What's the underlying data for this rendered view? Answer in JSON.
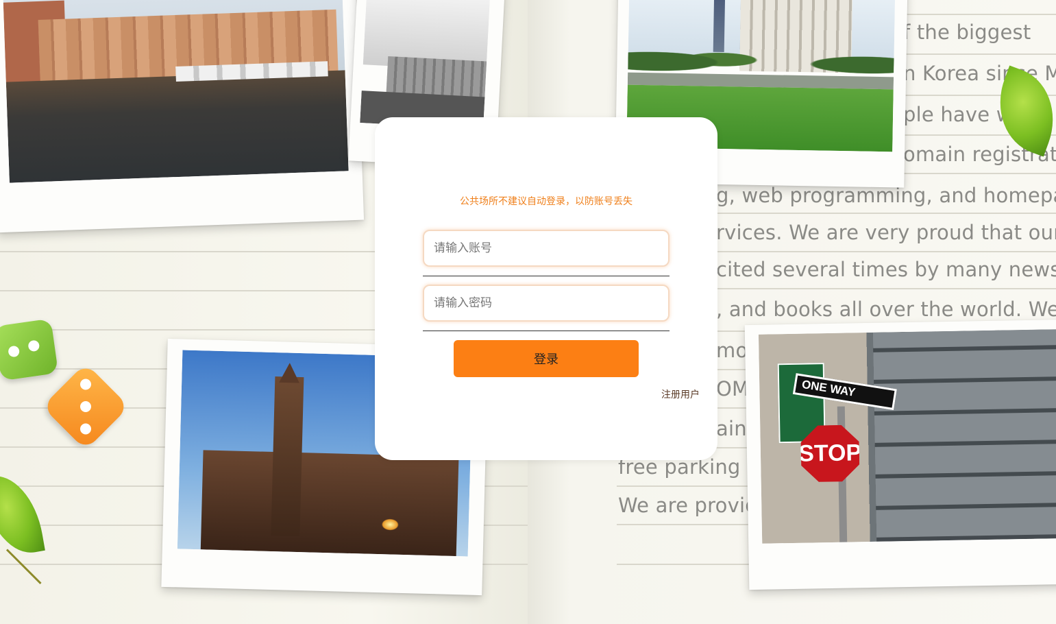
{
  "background": {
    "text_lines": [
      "f the biggest",
      "n Korea since Ma",
      "ple have w",
      "omain registratio",
      "g, web programming, and homepage",
      "rvices. We are very proud that  our si",
      "cited several times by many newspape",
      ", and books all over the world. We ha",
      "mo",
      "OM",
      "ain",
      "free parking a",
      "We are provid"
    ],
    "photo_sign_text": {
      "one_way": "ONE WAY",
      "stop": "STOP"
    }
  },
  "login": {
    "notice": "公共场所不建议自动登录，以防账号丢失",
    "account_placeholder": "请输入账号",
    "password_placeholder": "请输入密码",
    "login_label": "登录",
    "register_label": "注册用户"
  },
  "colors": {
    "accent": "#fc7f14",
    "notice": "#ef7f1a",
    "card": "#ffffff"
  }
}
